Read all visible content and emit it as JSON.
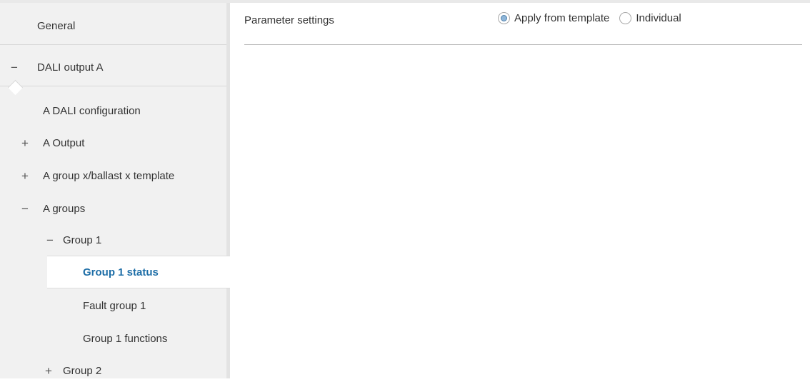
{
  "sidebar": {
    "general": "General",
    "dali_output": "DALI output A",
    "items": [
      {
        "sign": "",
        "label": "A DALI configuration"
      },
      {
        "sign": "+",
        "label": "A Output"
      },
      {
        "sign": "+",
        "label": "A group x/ballast x template"
      },
      {
        "sign": "−",
        "label": "A groups"
      },
      {
        "sign": "−",
        "label": "Group 1"
      },
      {
        "sign": "",
        "label": "Group 1 status"
      },
      {
        "sign": "",
        "label": "Fault group 1"
      },
      {
        "sign": "",
        "label": "Group 1 functions"
      },
      {
        "sign": "+",
        "label": "Group 2"
      }
    ],
    "collapse_sign": "−"
  },
  "main": {
    "param_label": "Parameter settings",
    "options": [
      {
        "label": "Apply from template",
        "checked": true
      },
      {
        "label": "Individual",
        "checked": false
      }
    ]
  },
  "colors": {
    "accent": "#1e6ea7",
    "sidebar_bg": "#f1f1f1"
  }
}
